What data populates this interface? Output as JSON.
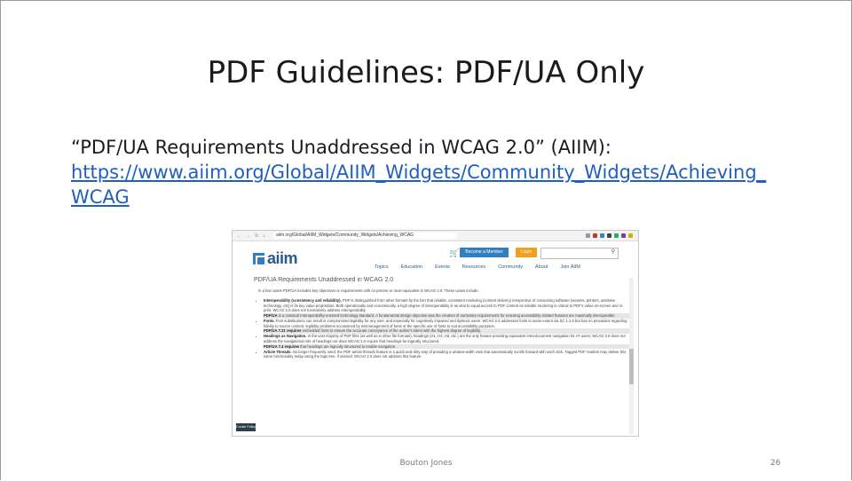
{
  "slide": {
    "title": "PDF Guidelines:  PDF/UA Only",
    "body_text": "“PDF/UA Requirements Unaddressed in WCAG 2.0” (AIIM):",
    "link": "https://www.aiim.org/Global/AIIM_Widgets/Community_Widgets/Achieving_WCAG",
    "footer_center": "Bouton Jones",
    "page_number": "26"
  },
  "screenshot": {
    "url": "aiim.org/Global/AIIM_Widgets/Community_Widgets/Achieving_WCAG",
    "logo_text": "aiim",
    "member_button": "Become a Member",
    "login_button": "Login",
    "search_icon": "magnifier-icon",
    "nav": [
      "Topics",
      "Education",
      "Events",
      "Resources",
      "Community",
      "About",
      "Join AIIM"
    ],
    "heading": "PDF/UA Requirements Unaddressed in WCAG 2.0",
    "intro": "In a few cases PDF/UA includes key objectives or requirements with no precise or near-equivalent in WCAG 2.0. These cases include:",
    "items": [
      {
        "lead": "Interoperability (consistency and reliability).",
        "text": " PDF is distinguished from other formats by the fact that reliable, consistent rendering (content delivery) irrespective of consuming software (viewers, printers, assistive technology, etc) is its key value proposition. Both operationally and economically, a high degree of interoperability is as vital to equal access to PDF content as reliable rendering is critical to PDF's value on-screen and in-print. WCAG 2.0 does not normatively address interoperability.",
        "note_lead": "PDF/UA",
        "note": " is a classical interoperability-oriented technology standard. A fundamental design objective was the creation of normative requirements for ensuring accessibility-related features are maximally interoperable."
      },
      {
        "lead": "Fonts.",
        "text": " Font substitutions can result in compromised legibility for any user, and especially for cognitively impaired and dyslexic users. WCAG 2.0 addresses fonts to some extent via SC 1.4.5 but has no provisions regarding fidelity to source content, legibility problems occasioned by mismanagement of fonts or the specific use of fonts to suit accessibility purposes.",
        "note_lead": "PDF/UA 7.21 requires",
        "note": " embedded fonts to ensure the accurate conveyance of the author's intent with the highest degree of legibility."
      },
      {
        "lead": "Headings as Navigation.",
        "text": " In the vast majority of PDF files (as well as in other file formats), headings (H1, H2, H3, etc.) are the only feature providing equivalent intra-document navigation for AT users. WCAG 2.0 does not address the navigational role of headings nor does WCAG 2.0 require that headings be logically structured.",
        "note_lead": "PDF/UA 7.4 requires",
        "note": " that headings are logically structured to enable navigation."
      },
      {
        "lead": "Article Threads.",
        "text": " No longer frequently used, the PDF article threads feature is a quick-and-dirty way of providing a window-width view that automatically scrolls forward with each click. Tagged PDF readers may deliver this same functionality today using the tags tree, if desired. WCAG 2.0 does not address this feature.",
        "note_lead": "",
        "note": ""
      }
    ],
    "cookie_policy": "Cookie Policy"
  }
}
